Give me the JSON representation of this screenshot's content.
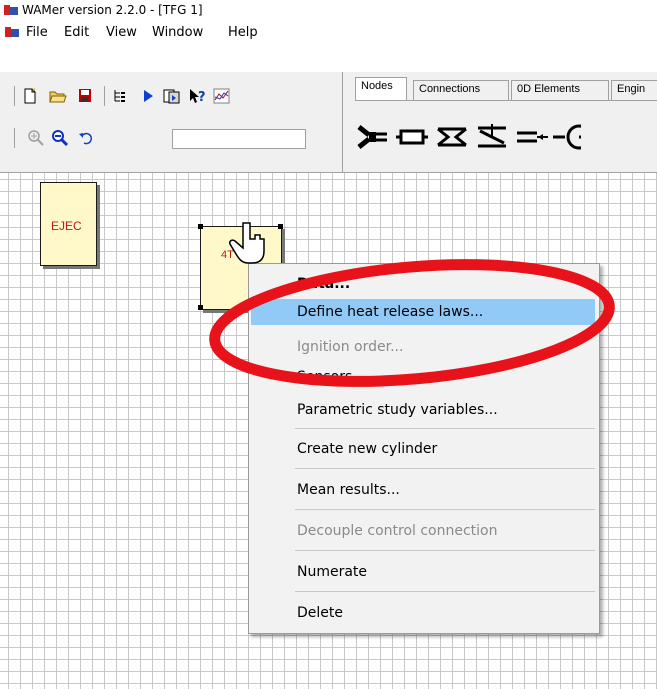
{
  "window": {
    "title": "WAMer version 2.2.0 - [TFG 1]"
  },
  "menubar": [
    "File",
    "Edit",
    "View",
    "Window",
    "Help"
  ],
  "tabs": [
    "Nodes",
    "Connections",
    "0D Elements",
    "Engin"
  ],
  "canvas": {
    "node_ejec": "EJEC",
    "node_cyl": "4T"
  },
  "context_menu": {
    "items": [
      {
        "label": "Data...",
        "state": "bold"
      },
      {
        "label": "Define heat release laws...",
        "state": "highlighted"
      },
      {
        "label": "Ignition order...",
        "state": "disabled"
      },
      {
        "label": "Sensors...",
        "state": "normal"
      },
      {
        "label": "Parametric study variables...",
        "state": "normal"
      },
      {
        "label": "Create new cylinder",
        "state": "normal"
      },
      {
        "label": "Mean results...",
        "state": "normal"
      },
      {
        "label": "Decouple control connection",
        "state": "disabled"
      },
      {
        "label": "Numerate",
        "state": "normal"
      },
      {
        "label": "Delete",
        "state": "normal"
      }
    ]
  },
  "colors": {
    "highlight": "#91c9f7",
    "annotation_ring": "#e8121b",
    "node_fill": "#fff8c8",
    "node_text": "#c01818"
  }
}
